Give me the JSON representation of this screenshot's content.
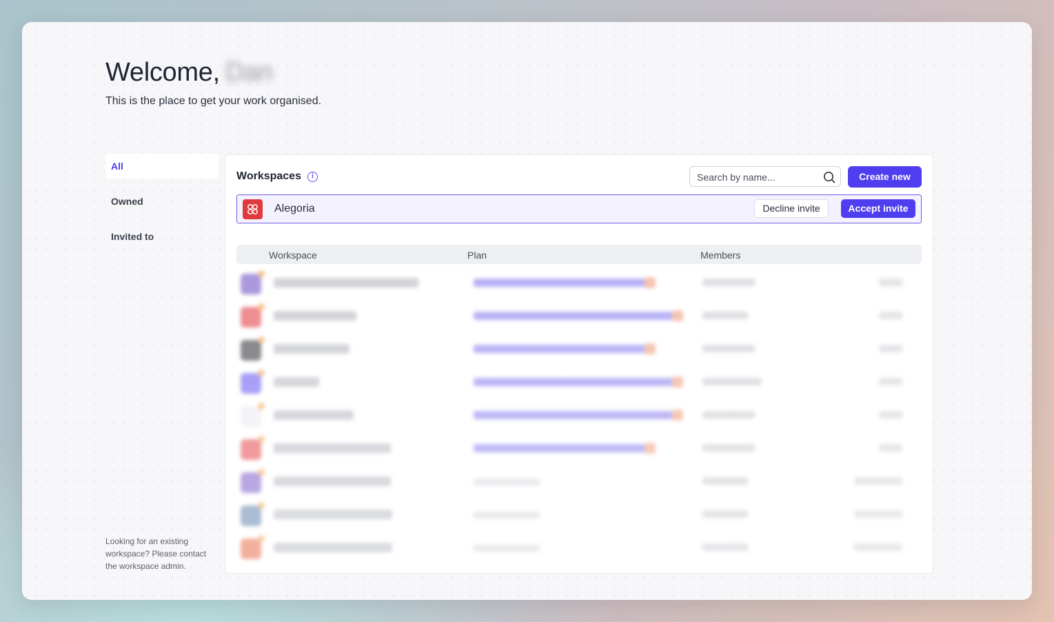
{
  "header": {
    "greeting": "Welcome,",
    "username": "Dan",
    "subtitle": "This is the place to get your work organised."
  },
  "sidebar": {
    "items": [
      {
        "label": "All",
        "active": true
      },
      {
        "label": "Owned",
        "active": false
      },
      {
        "label": "Invited to",
        "active": false
      }
    ],
    "help_text": "Looking for an existing workspace? Please contact the workspace admin."
  },
  "workspaces": {
    "title": "Workspaces",
    "info_icon": "info-icon",
    "search": {
      "placeholder": "Search by name...",
      "value": "",
      "icon": "search-icon"
    },
    "create_label": "Create new",
    "invite": {
      "name": "Alegoria",
      "logo_color": "#e0393e",
      "decline_label": "Decline invite",
      "accept_label": "Accept invite"
    },
    "table": {
      "columns": [
        "Workspace",
        "Plan",
        "Members"
      ]
    }
  },
  "colors": {
    "accent": "#4f3df0",
    "invite_bg": "#f4f2fe",
    "invite_border": "#6b5ee8"
  }
}
